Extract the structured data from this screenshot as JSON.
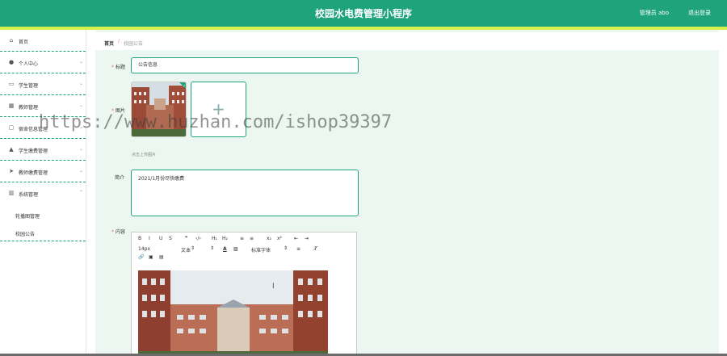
{
  "header": {
    "title": "校园水电费管理小程序",
    "user_label": "管理员 abo",
    "logout_label": "退出登录"
  },
  "sidebar": {
    "items": [
      {
        "label": "首页",
        "icon": "home-icon",
        "has_arrow": false
      },
      {
        "label": "个人中心",
        "icon": "user-icon",
        "has_arrow": true
      },
      {
        "label": "学生管理",
        "icon": "monitor-icon",
        "has_arrow": true
      },
      {
        "label": "教师管理",
        "icon": "grid-icon",
        "has_arrow": true
      },
      {
        "label": "宿舍信息管理",
        "icon": "chat-icon",
        "has_arrow": true
      },
      {
        "label": "学生缴费管理",
        "icon": "chart-icon",
        "has_arrow": true
      },
      {
        "label": "教师缴费管理",
        "icon": "send-icon",
        "has_arrow": true
      },
      {
        "label": "系统管理",
        "icon": "stats-icon",
        "has_arrow": true
      }
    ],
    "sub_items": [
      "轮播图管理",
      "校园公告"
    ]
  },
  "breadcrumb": {
    "home": "首页",
    "separator": "/",
    "current": "校园公告"
  },
  "form": {
    "title_label": "标题",
    "title_value": "公告信息",
    "image_label": "图片",
    "upload_tip": "点击上传图片",
    "intro_label": "简介",
    "intro_value": "2021/1月份尽快缴费",
    "content_label": "内容"
  },
  "editor": {
    "row1": [
      "B",
      "I",
      "U",
      "S",
      "❞",
      "‹/›",
      "H₁",
      "H₂",
      "≡",
      "≡",
      "x₂",
      "x²",
      "⇤",
      "⇥"
    ],
    "font_size": "14px",
    "text_style": "文本",
    "font_family": "标准字体",
    "row3": [
      "🔗",
      "▣",
      "▤"
    ]
  },
  "watermark": "https://www.huzhan.com/ishop39397",
  "colors": {
    "primary": "#1ea37b",
    "accent_bar": "#d8f04d",
    "required_star": "#f56c6c",
    "main_bg": "#ebf7f0"
  }
}
